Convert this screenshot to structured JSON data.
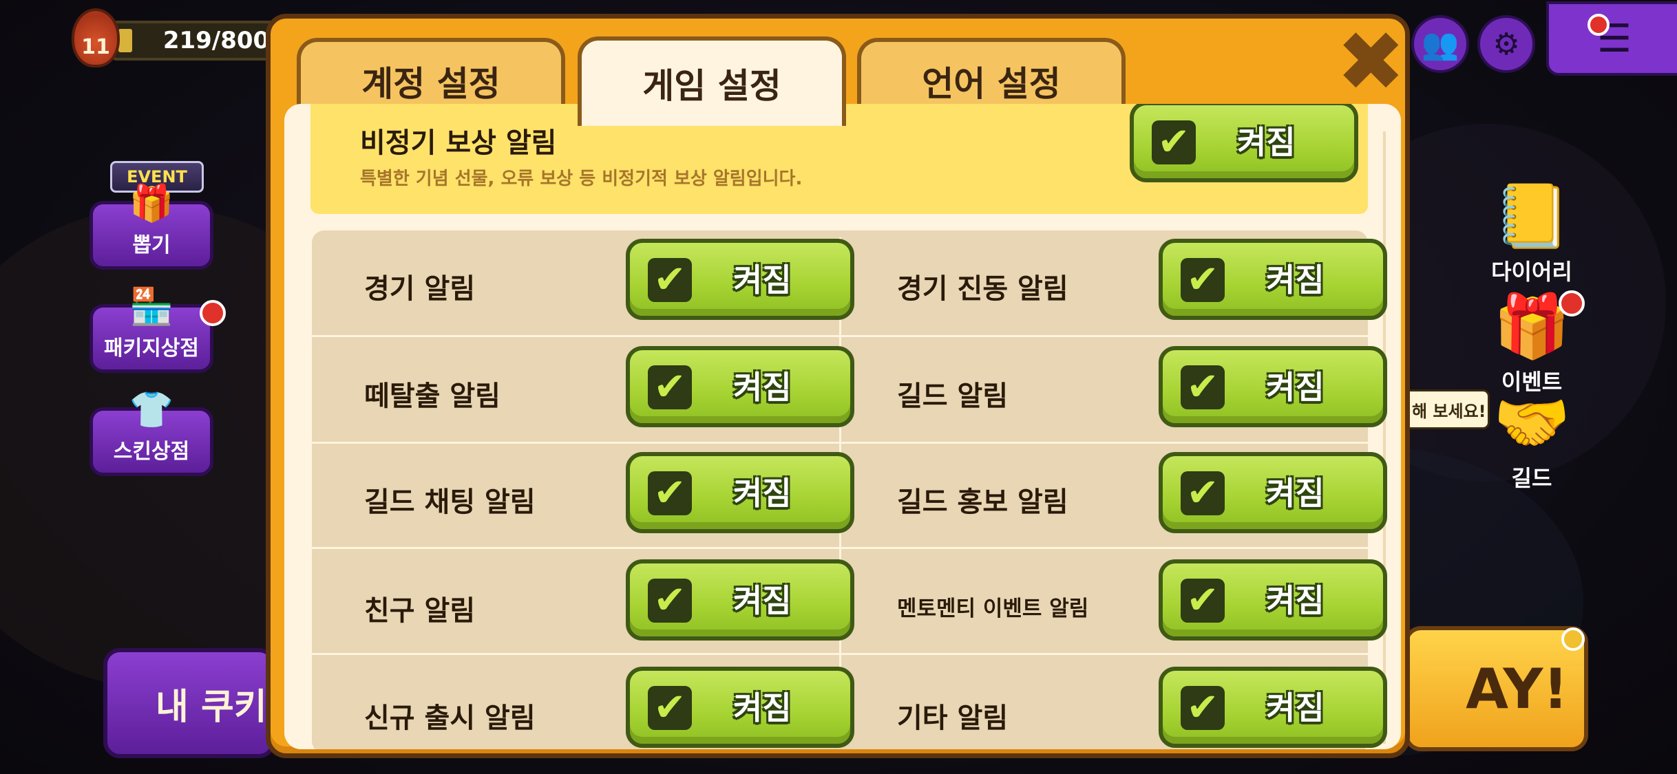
{
  "hud": {
    "level": "11",
    "stamina": "219/800"
  },
  "left_menu": {
    "event_tag": "EVENT",
    "items": [
      {
        "label": "뽑기",
        "icon": "chest-icon"
      },
      {
        "label": "패키지상점",
        "icon": "shop-icon"
      },
      {
        "label": "스킨상점",
        "icon": "shirt-icon"
      }
    ]
  },
  "right_menu": {
    "items": [
      {
        "label": "다이어리",
        "icon": "diary-icon"
      },
      {
        "label": "이벤트",
        "icon": "gift-icon"
      },
      {
        "label": "길드",
        "icon": "handshake-icon"
      }
    ],
    "speech_bubble": "해 보세요!"
  },
  "bottom": {
    "left_button": "내 쿠키들",
    "right_button": "AY!"
  },
  "dialog": {
    "tabs": [
      {
        "label": "계정 설정",
        "active": false
      },
      {
        "label": "게임 설정",
        "active": true
      },
      {
        "label": "언어 설정",
        "active": false
      }
    ],
    "featured": {
      "title": "비정기 보상 알림",
      "description": "특별한 기념 선물, 오류 보상 등 비정기적 보상 알림입니다.",
      "toggle_label": "켜짐",
      "checked": true
    },
    "settings": [
      {
        "label": "경기 알림",
        "toggle": "켜짐",
        "checked": true
      },
      {
        "label": "경기 진동 알림",
        "toggle": "켜짐",
        "checked": true
      },
      {
        "label": "떼탈출 알림",
        "toggle": "켜짐",
        "checked": true
      },
      {
        "label": "길드 알림",
        "toggle": "켜짐",
        "checked": true
      },
      {
        "label": "길드 채팅 알림",
        "toggle": "켜짐",
        "checked": true
      },
      {
        "label": "길드 홍보 알림",
        "toggle": "켜짐",
        "checked": true
      },
      {
        "label": "친구 알림",
        "toggle": "켜짐",
        "checked": true
      },
      {
        "label": "멘토멘티 이벤트 알림",
        "toggle": "켜짐",
        "checked": true
      },
      {
        "label": "신규 출시 알림",
        "toggle": "켜짐",
        "checked": true
      },
      {
        "label": "기타 알림",
        "toggle": "켜짐",
        "checked": true
      }
    ]
  },
  "colors": {
    "dialog_frame": "#f3a41b",
    "toggle_on": "#a6d332",
    "featured_bg": "#fee26a",
    "hud_purple": "#7e33cc"
  }
}
